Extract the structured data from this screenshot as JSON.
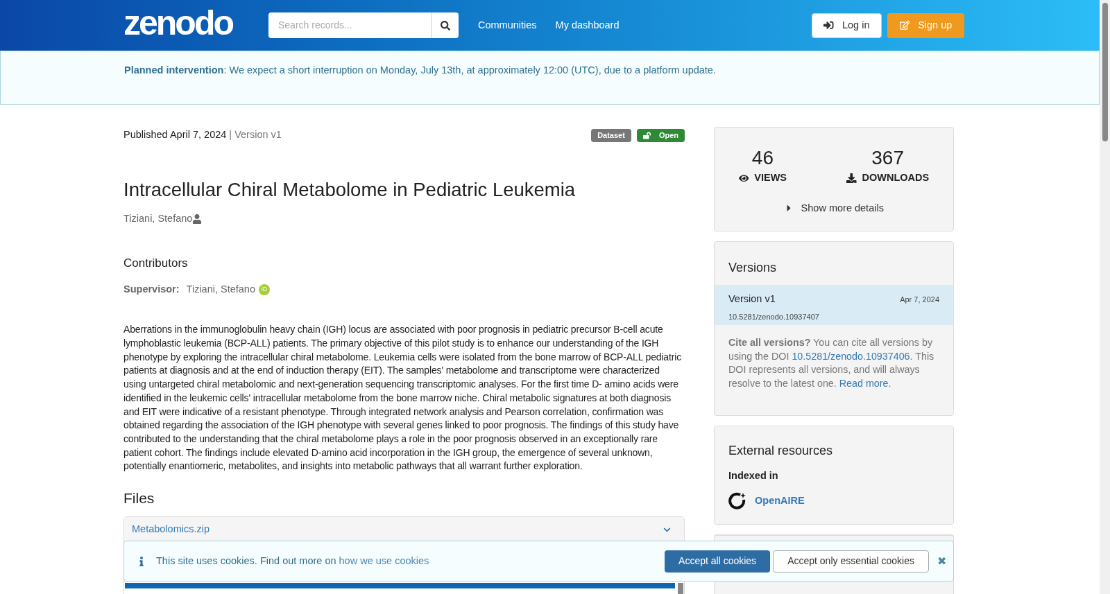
{
  "header": {
    "logo": "zenodo",
    "search": {
      "placeholder": "Search records..."
    },
    "nav": [
      "Communities",
      "My dashboard"
    ],
    "login": "Log in",
    "signup": "Sign up"
  },
  "notice": {
    "text": "**Planned intervention**: We expect a short interruption on Monday, July 13th, at approximately 12:00 (UTC), due to a platform update."
  },
  "record": {
    "published": "Published April 7, 2024",
    "version": "| Version v1",
    "badges": [
      {
        "kind": "type",
        "label": "Dataset"
      },
      {
        "kind": "access",
        "label": "Open"
      }
    ],
    "title": "Intracellular Chiral Metabolome in Pediatric Leukemia",
    "creator": "Tiziani, Stefano",
    "contributors_heading": "Contributors",
    "contributor_role": "Supervisor:",
    "contributor_name": "Tiziani, Stefano",
    "orcid": "iD",
    "abstract": "Aberrations in the immunoglobulin heavy chain (IGH) locus are associated with poor prognosis in pediatric precursor B-cell acute lymphoblastic leukemia (BCP-ALL) patients. The primary objective of this pilot study is to enhance our understanding of the IGH phenotype by exploring the intracellular chiral metabolome. Leukemia cells were isolated from the bone marrow of BCP-ALL pediatric patients at diagnosis and at the end of induction therapy (EIT). The samples' metabolome and transcriptome were characterized using untargeted chiral metabolomic and next-generation sequencing transcriptomic analyses. For the first time D- amino acids were identified in the leukemic cells' intracellular metabolome from the bone marrow niche. Chiral metabolic signatures at both diagnosis and EIT were indicative of a resistant phenotype. Through integrated network analysis and Pearson correlation, confirmation was obtained regarding the association of the IGH phenotype with several genes linked to poor prognosis. The findings of this study have contributed to the understanding that the chiral metabolome plays a role in the poor prognosis observed in an exceptionally rare patient cohort. The findings include elevated D-amino acid incorporation in the IGH group, the emergence of several unknown, potentially enantiomeric, metabolites, and insights into metabolic pathways that all warrant further exploration.",
    "files_heading": "Files",
    "file": {
      "name": "Metabolomics.zip",
      "expanded": true
    }
  },
  "stats": [
    {
      "kind": "views",
      "value": "46",
      "label": "VIEWS"
    },
    {
      "kind": "downloads",
      "value": "367",
      "label": "DOWNLOADS"
    }
  ],
  "show_more": "Show more details",
  "versions": {
    "heading": "Versions",
    "items": [
      {
        "name": "Version v1",
        "date": "Apr 7, 2024",
        "doi": "10.5281/zenodo.10937407",
        "selected": true
      }
    ],
    "cite_lead": "Cite all versions?",
    "cite_text1": "You can cite all versions by using the DOI",
    "cite_doi": "10.5281/zenodo.10937406",
    "cite_text2": ". This DOI represents all versions, and will always resolve to the latest one.",
    "read_more": "Read more",
    "cite_end": "."
  },
  "external": {
    "heading": "External resources",
    "subheading": "Indexed in",
    "link": "OpenAIRE"
  },
  "cookies": {
    "text": "This site uses cookies. Find out more on",
    "link": "how we use cookies",
    "accept_all": "Accept all cookies",
    "accept_essential": "Accept only essential cookies",
    "close": "✖"
  }
}
